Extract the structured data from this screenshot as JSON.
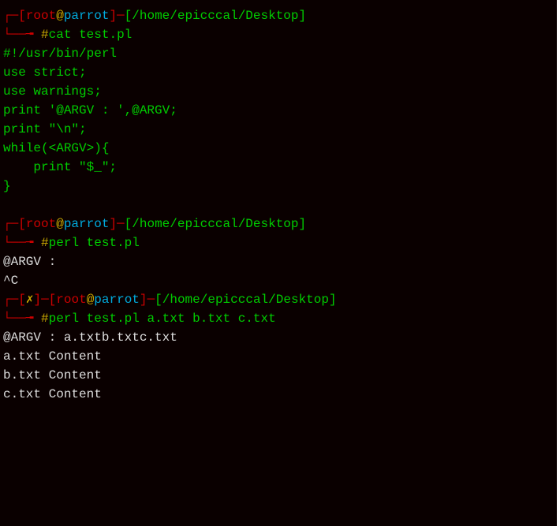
{
  "prompt1": {
    "bracket_open_top": "┌─",
    "bracket_open_bottom": "└──╼ ",
    "user_open": "[",
    "user": "root",
    "at": "@",
    "host": "parrot",
    "user_close": "]",
    "dash": "─",
    "path_open": "[",
    "path": "/home/epicccal/Desktop",
    "path_close": "]",
    "hash": "#",
    "cmd": "cat test.pl"
  },
  "file_content": {
    "l1": "#!/usr/bin/perl",
    "l2": "",
    "l3": "use strict;",
    "l4": "use warnings;",
    "l5": "",
    "l6": "print '@ARGV : ',@ARGV;",
    "l7": "print \"\\n\";",
    "l8": "",
    "l9": "while(<ARGV>){",
    "l10": "    print \"$_\";",
    "l11": "}"
  },
  "prompt2": {
    "bracket_open_top": "┌─",
    "bracket_open_bottom": "└──╼ ",
    "user_open": "[",
    "user": "root",
    "at": "@",
    "host": "parrot",
    "user_close": "]",
    "dash": "─",
    "path_open": "[",
    "path": "/home/epicccal/Desktop",
    "path_close": "]",
    "hash": "#",
    "cmd": "perl test.pl"
  },
  "output2": {
    "l1": "@ARGV : ",
    "l2": "^C"
  },
  "prompt3": {
    "bracket_open_top": "┌─",
    "status_open": "[",
    "status_x": "✗",
    "status_close": "]",
    "dash1": "─",
    "bracket_open_bottom": "└──╼ ",
    "user_open": "[",
    "user": "root",
    "at": "@",
    "host": "parrot",
    "user_close": "]",
    "dash": "─",
    "path_open": "[",
    "path": "/home/epicccal/Desktop",
    "path_close": "]",
    "hash": "#",
    "cmd": "perl test.pl a.txt b.txt c.txt"
  },
  "output3": {
    "l1": "@ARGV : a.txtb.txtc.txt",
    "l2": "a.txt Content",
    "l3": "b.txt Content",
    "l4": "c.txt Content"
  }
}
